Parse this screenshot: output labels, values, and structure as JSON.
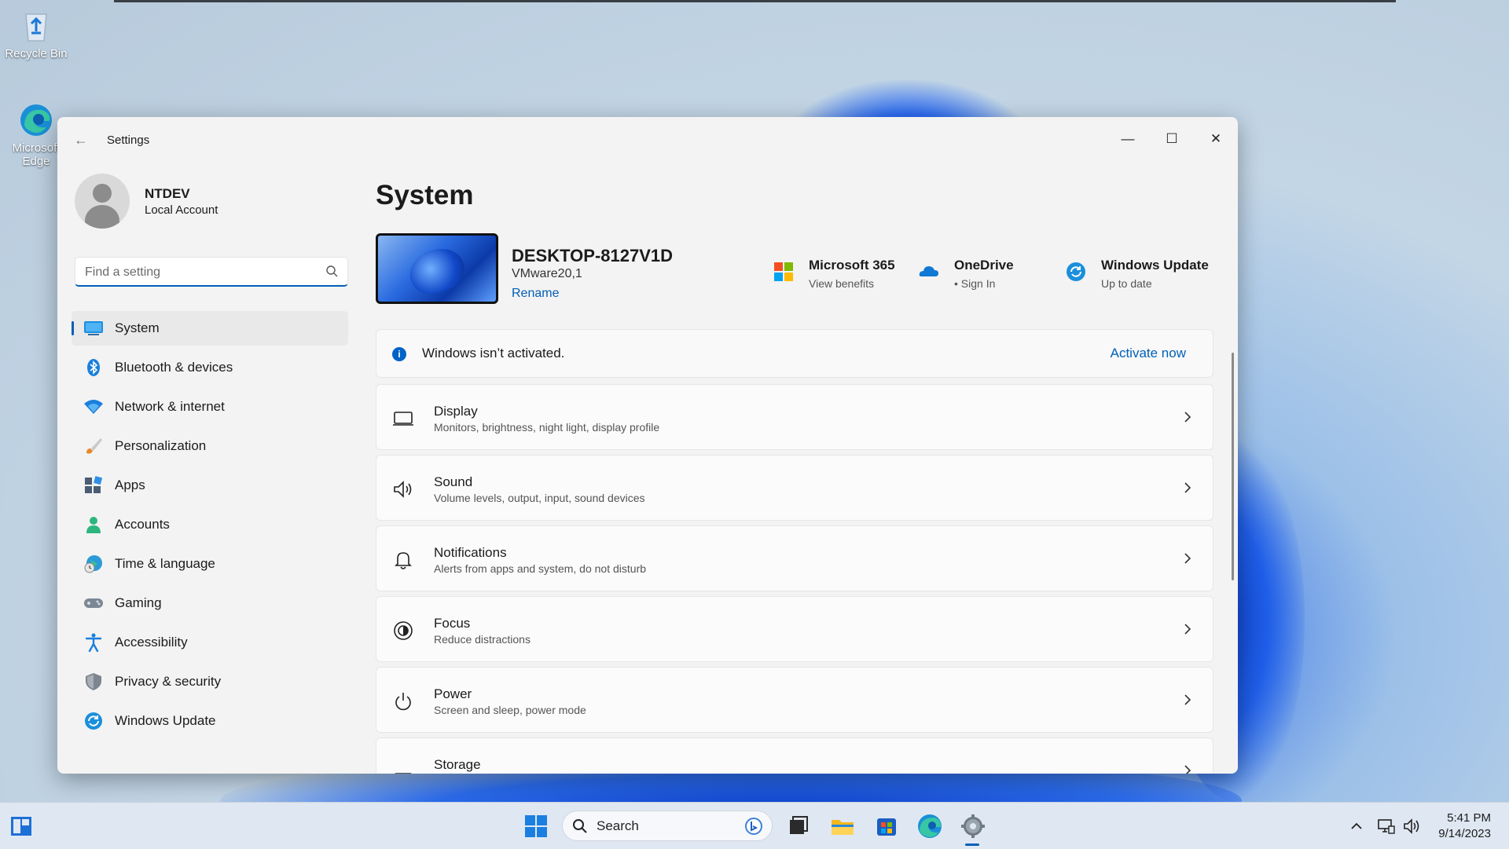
{
  "desktop": {
    "icons": [
      {
        "label": "Recycle Bin",
        "icon": "recycle-bin-icon"
      },
      {
        "label": "Microsoft Edge",
        "icon": "edge-icon"
      }
    ]
  },
  "window": {
    "title": "Settings",
    "controls": {
      "minimize": "—",
      "maximize": "☐",
      "close": "✕"
    }
  },
  "profile": {
    "name": "NTDEV",
    "account": "Local Account"
  },
  "search": {
    "placeholder": "Find a setting",
    "value": ""
  },
  "nav": {
    "items": [
      {
        "label": "System",
        "icon": "system-icon",
        "active": true
      },
      {
        "label": "Bluetooth & devices",
        "icon": "bluetooth-icon"
      },
      {
        "label": "Network & internet",
        "icon": "wifi-icon"
      },
      {
        "label": "Personalization",
        "icon": "brush-icon"
      },
      {
        "label": "Apps",
        "icon": "apps-icon"
      },
      {
        "label": "Accounts",
        "icon": "accounts-icon"
      },
      {
        "label": "Time & language",
        "icon": "globe-clock-icon"
      },
      {
        "label": "Gaming",
        "icon": "gamepad-icon"
      },
      {
        "label": "Accessibility",
        "icon": "accessibility-icon"
      },
      {
        "label": "Privacy & security",
        "icon": "shield-icon"
      },
      {
        "label": "Windows Update",
        "icon": "update-icon"
      }
    ]
  },
  "main": {
    "title": "System",
    "device": {
      "name": "DESKTOP-8127V1D",
      "model": "VMware20,1",
      "rename": "Rename"
    },
    "quick_links": [
      {
        "title": "Microsoft 365",
        "subtitle": "View benefits",
        "icon": "microsoft-365-icon"
      },
      {
        "title": "OneDrive",
        "subtitle": "• Sign In",
        "icon": "onedrive-icon"
      },
      {
        "title": "Windows Update",
        "subtitle": "Up to date",
        "icon": "windows-update-icon"
      }
    ],
    "activation": {
      "message": "Windows isn’t activated.",
      "action": "Activate now"
    },
    "cards": [
      {
        "title": "Display",
        "subtitle": "Monitors, brightness, night light, display profile",
        "icon": "display-icon"
      },
      {
        "title": "Sound",
        "subtitle": "Volume levels, output, input, sound devices",
        "icon": "speaker-icon"
      },
      {
        "title": "Notifications",
        "subtitle": "Alerts from apps and system, do not disturb",
        "icon": "bell-icon"
      },
      {
        "title": "Focus",
        "subtitle": "Reduce distractions",
        "icon": "focus-icon"
      },
      {
        "title": "Power",
        "subtitle": "Screen and sleep, power mode",
        "icon": "power-icon"
      },
      {
        "title": "Storage",
        "subtitle": "",
        "icon": "storage-icon"
      }
    ]
  },
  "taskbar": {
    "search_label": "Search",
    "time": "5:41 PM",
    "date": "9/14/2023"
  },
  "colors": {
    "accent": "#005fb8",
    "window_bg": "#f3f3f3",
    "taskbar_bg": "#dfe8f2"
  }
}
